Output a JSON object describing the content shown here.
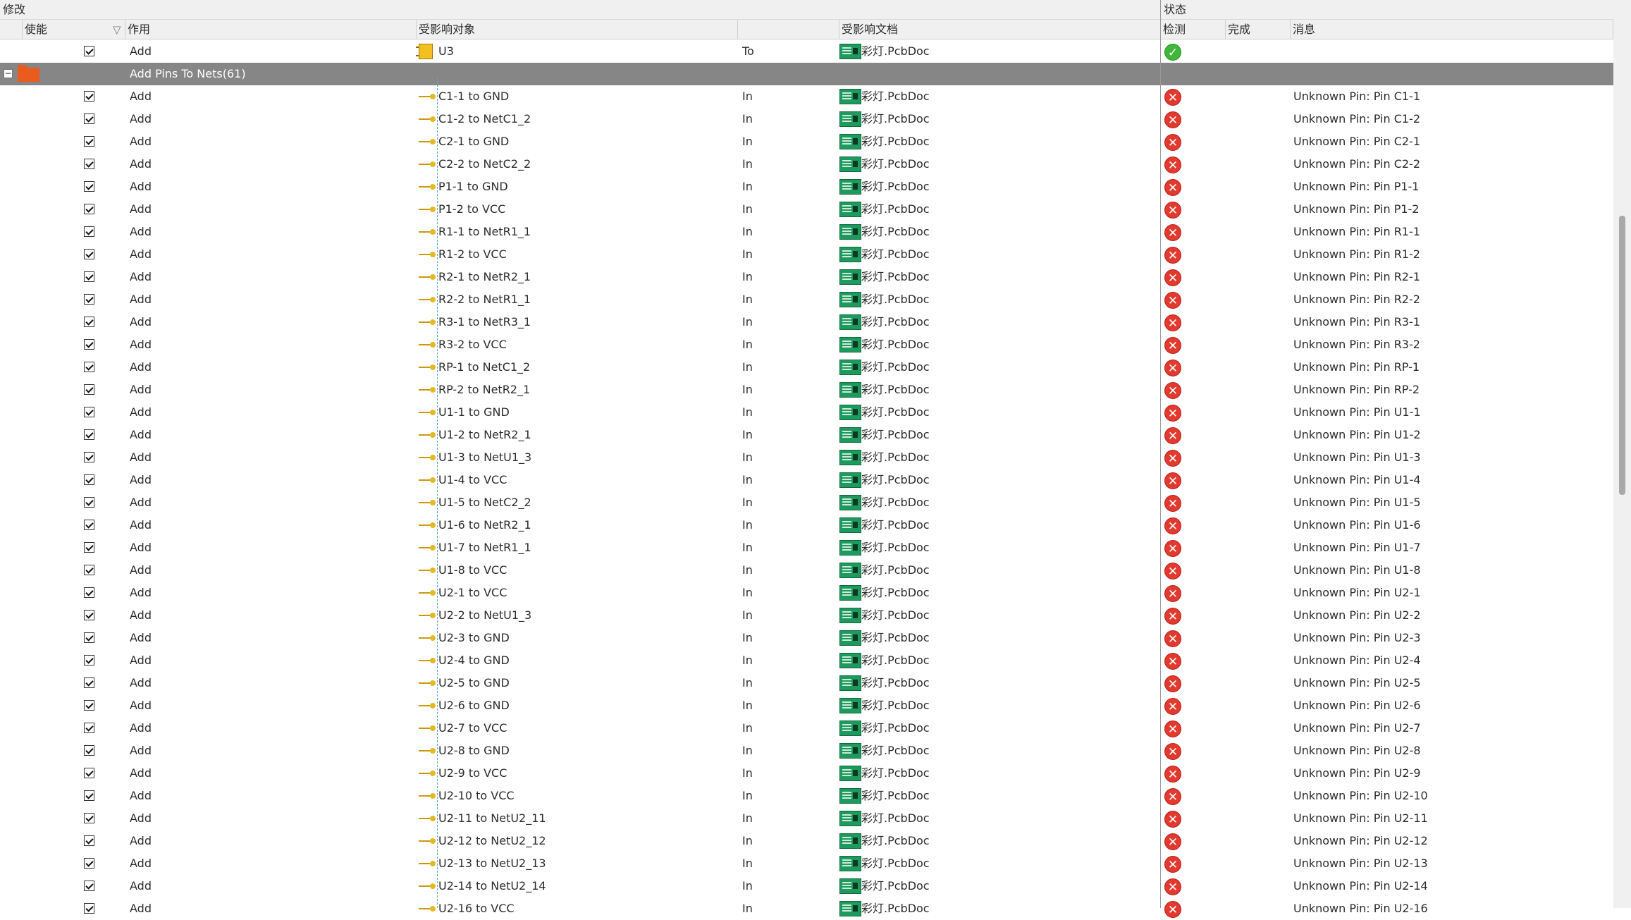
{
  "group_headers": {
    "modify": "修改",
    "status": "状态"
  },
  "columns": {
    "enable": "使能",
    "action": "作用",
    "affected_object": "受影响对象",
    "affected_document": "受影响文档",
    "check": "检测",
    "done": "完成",
    "message": "消息"
  },
  "filter_icon": "filter-icon",
  "top_row": {
    "action": "Add",
    "object": "U3",
    "direction": "To",
    "document": "彩灯.PcbDoc",
    "status": "ok",
    "checked": true
  },
  "group_row": {
    "label": "Add Pins To Nets(61)",
    "expander": "−"
  },
  "rows": [
    {
      "checked": true,
      "action": "Add",
      "object": "C1-1 to GND",
      "direction": "In",
      "document": "彩灯.PcbDoc",
      "status": "error",
      "message": "Unknown Pin: Pin C1-1"
    },
    {
      "checked": true,
      "action": "Add",
      "object": "C1-2 to NetC1_2",
      "direction": "In",
      "document": "彩灯.PcbDoc",
      "status": "error",
      "message": "Unknown Pin: Pin C1-2"
    },
    {
      "checked": true,
      "action": "Add",
      "object": "C2-1 to GND",
      "direction": "In",
      "document": "彩灯.PcbDoc",
      "status": "error",
      "message": "Unknown Pin: Pin C2-1"
    },
    {
      "checked": true,
      "action": "Add",
      "object": "C2-2 to NetC2_2",
      "direction": "In",
      "document": "彩灯.PcbDoc",
      "status": "error",
      "message": "Unknown Pin: Pin C2-2"
    },
    {
      "checked": true,
      "action": "Add",
      "object": "P1-1 to GND",
      "direction": "In",
      "document": "彩灯.PcbDoc",
      "status": "error",
      "message": "Unknown Pin: Pin P1-1"
    },
    {
      "checked": true,
      "action": "Add",
      "object": "P1-2 to VCC",
      "direction": "In",
      "document": "彩灯.PcbDoc",
      "status": "error",
      "message": "Unknown Pin: Pin P1-2"
    },
    {
      "checked": true,
      "action": "Add",
      "object": "R1-1 to NetR1_1",
      "direction": "In",
      "document": "彩灯.PcbDoc",
      "status": "error",
      "message": "Unknown Pin: Pin R1-1"
    },
    {
      "checked": true,
      "action": "Add",
      "object": "R1-2 to VCC",
      "direction": "In",
      "document": "彩灯.PcbDoc",
      "status": "error",
      "message": "Unknown Pin: Pin R1-2"
    },
    {
      "checked": true,
      "action": "Add",
      "object": "R2-1 to NetR2_1",
      "direction": "In",
      "document": "彩灯.PcbDoc",
      "status": "error",
      "message": "Unknown Pin: Pin R2-1"
    },
    {
      "checked": true,
      "action": "Add",
      "object": "R2-2 to NetR1_1",
      "direction": "In",
      "document": "彩灯.PcbDoc",
      "status": "error",
      "message": "Unknown Pin: Pin R2-2"
    },
    {
      "checked": true,
      "action": "Add",
      "object": "R3-1 to NetR3_1",
      "direction": "In",
      "document": "彩灯.PcbDoc",
      "status": "error",
      "message": "Unknown Pin: Pin R3-1"
    },
    {
      "checked": true,
      "action": "Add",
      "object": "R3-2 to VCC",
      "direction": "In",
      "document": "彩灯.PcbDoc",
      "status": "error",
      "message": "Unknown Pin: Pin R3-2"
    },
    {
      "checked": true,
      "action": "Add",
      "object": "RP-1 to NetC1_2",
      "direction": "In",
      "document": "彩灯.PcbDoc",
      "status": "error",
      "message": "Unknown Pin: Pin RP-1"
    },
    {
      "checked": true,
      "action": "Add",
      "object": "RP-2 to NetR2_1",
      "direction": "In",
      "document": "彩灯.PcbDoc",
      "status": "error",
      "message": "Unknown Pin: Pin RP-2"
    },
    {
      "checked": true,
      "action": "Add",
      "object": "U1-1 to GND",
      "direction": "In",
      "document": "彩灯.PcbDoc",
      "status": "error",
      "message": "Unknown Pin: Pin U1-1"
    },
    {
      "checked": true,
      "action": "Add",
      "object": "U1-2 to NetR2_1",
      "direction": "In",
      "document": "彩灯.PcbDoc",
      "status": "error",
      "message": "Unknown Pin: Pin U1-2"
    },
    {
      "checked": true,
      "action": "Add",
      "object": "U1-3 to NetU1_3",
      "direction": "In",
      "document": "彩灯.PcbDoc",
      "status": "error",
      "message": "Unknown Pin: Pin U1-3"
    },
    {
      "checked": true,
      "action": "Add",
      "object": "U1-4 to VCC",
      "direction": "In",
      "document": "彩灯.PcbDoc",
      "status": "error",
      "message": "Unknown Pin: Pin U1-4"
    },
    {
      "checked": true,
      "action": "Add",
      "object": "U1-5 to NetC2_2",
      "direction": "In",
      "document": "彩灯.PcbDoc",
      "status": "error",
      "message": "Unknown Pin: Pin U1-5"
    },
    {
      "checked": true,
      "action": "Add",
      "object": "U1-6 to NetR2_1",
      "direction": "In",
      "document": "彩灯.PcbDoc",
      "status": "error",
      "message": "Unknown Pin: Pin U1-6"
    },
    {
      "checked": true,
      "action": "Add",
      "object": "U1-7 to NetR1_1",
      "direction": "In",
      "document": "彩灯.PcbDoc",
      "status": "error",
      "message": "Unknown Pin: Pin U1-7"
    },
    {
      "checked": true,
      "action": "Add",
      "object": "U1-8 to VCC",
      "direction": "In",
      "document": "彩灯.PcbDoc",
      "status": "error",
      "message": "Unknown Pin: Pin U1-8"
    },
    {
      "checked": true,
      "action": "Add",
      "object": "U2-1 to VCC",
      "direction": "In",
      "document": "彩灯.PcbDoc",
      "status": "error",
      "message": "Unknown Pin: Pin U2-1"
    },
    {
      "checked": true,
      "action": "Add",
      "object": "U2-2 to NetU1_3",
      "direction": "In",
      "document": "彩灯.PcbDoc",
      "status": "error",
      "message": "Unknown Pin: Pin U2-2"
    },
    {
      "checked": true,
      "action": "Add",
      "object": "U2-3 to GND",
      "direction": "In",
      "document": "彩灯.PcbDoc",
      "status": "error",
      "message": "Unknown Pin: Pin U2-3"
    },
    {
      "checked": true,
      "action": "Add",
      "object": "U2-4 to GND",
      "direction": "In",
      "document": "彩灯.PcbDoc",
      "status": "error",
      "message": "Unknown Pin: Pin U2-4"
    },
    {
      "checked": true,
      "action": "Add",
      "object": "U2-5 to GND",
      "direction": "In",
      "document": "彩灯.PcbDoc",
      "status": "error",
      "message": "Unknown Pin: Pin U2-5"
    },
    {
      "checked": true,
      "action": "Add",
      "object": "U2-6 to GND",
      "direction": "In",
      "document": "彩灯.PcbDoc",
      "status": "error",
      "message": "Unknown Pin: Pin U2-6"
    },
    {
      "checked": true,
      "action": "Add",
      "object": "U2-7 to VCC",
      "direction": "In",
      "document": "彩灯.PcbDoc",
      "status": "error",
      "message": "Unknown Pin: Pin U2-7"
    },
    {
      "checked": true,
      "action": "Add",
      "object": "U2-8 to GND",
      "direction": "In",
      "document": "彩灯.PcbDoc",
      "status": "error",
      "message": "Unknown Pin: Pin U2-8"
    },
    {
      "checked": true,
      "action": "Add",
      "object": "U2-9 to VCC",
      "direction": "In",
      "document": "彩灯.PcbDoc",
      "status": "error",
      "message": "Unknown Pin: Pin U2-9"
    },
    {
      "checked": true,
      "action": "Add",
      "object": "U2-10 to VCC",
      "direction": "In",
      "document": "彩灯.PcbDoc",
      "status": "error",
      "message": "Unknown Pin: Pin U2-10"
    },
    {
      "checked": true,
      "action": "Add",
      "object": "U2-11 to NetU2_11",
      "direction": "In",
      "document": "彩灯.PcbDoc",
      "status": "error",
      "message": "Unknown Pin: Pin U2-11"
    },
    {
      "checked": true,
      "action": "Add",
      "object": "U2-12 to NetU2_12",
      "direction": "In",
      "document": "彩灯.PcbDoc",
      "status": "error",
      "message": "Unknown Pin: Pin U2-12"
    },
    {
      "checked": true,
      "action": "Add",
      "object": "U2-13 to NetU2_13",
      "direction": "In",
      "document": "彩灯.PcbDoc",
      "status": "error",
      "message": "Unknown Pin: Pin U2-13"
    },
    {
      "checked": true,
      "action": "Add",
      "object": "U2-14 to NetU2_14",
      "direction": "In",
      "document": "彩灯.PcbDoc",
      "status": "error",
      "message": "Unknown Pin: Pin U2-14"
    },
    {
      "checked": true,
      "action": "Add",
      "object": "U2-16 to VCC",
      "direction": "In",
      "document": "彩灯.PcbDoc",
      "status": "error",
      "message": "Unknown Pin: Pin U2-16"
    }
  ]
}
